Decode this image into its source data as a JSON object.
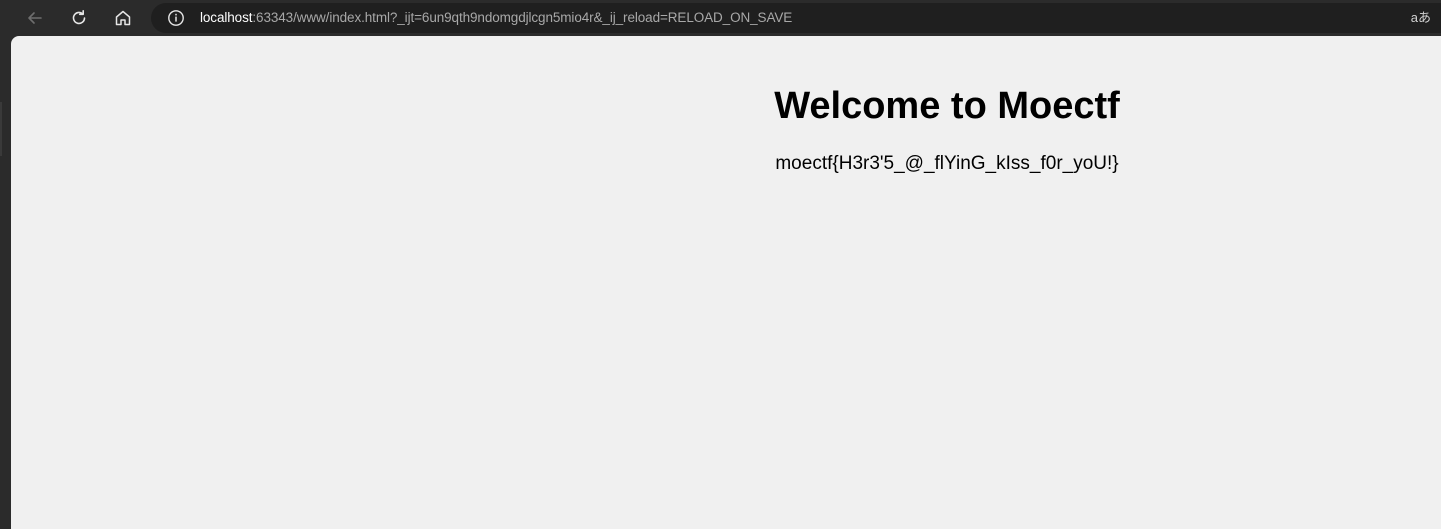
{
  "browser": {
    "nav": {
      "back_icon": "arrow-left-icon",
      "reload_icon": "reload-icon",
      "home_icon": "home-icon"
    },
    "address_bar": {
      "info_icon": "info-icon",
      "host": "localhost",
      "rest": ":63343/www/index.html?_ijt=6un9qth9ndomgdjlcgn5mio4r&_ij_reload=RELOAD_ON_SAVE"
    },
    "read_aloud_label": "aあ"
  },
  "page": {
    "title": "Welcome to Moectf",
    "flag": "moectf{H3r3'5_@_flYinG_kIss_f0r_yoU!}"
  },
  "colors": {
    "chrome_bg": "#2b2b2b",
    "address_bg": "#1f1f1f",
    "page_bg": "#f0f0f0",
    "text": "#000000"
  }
}
